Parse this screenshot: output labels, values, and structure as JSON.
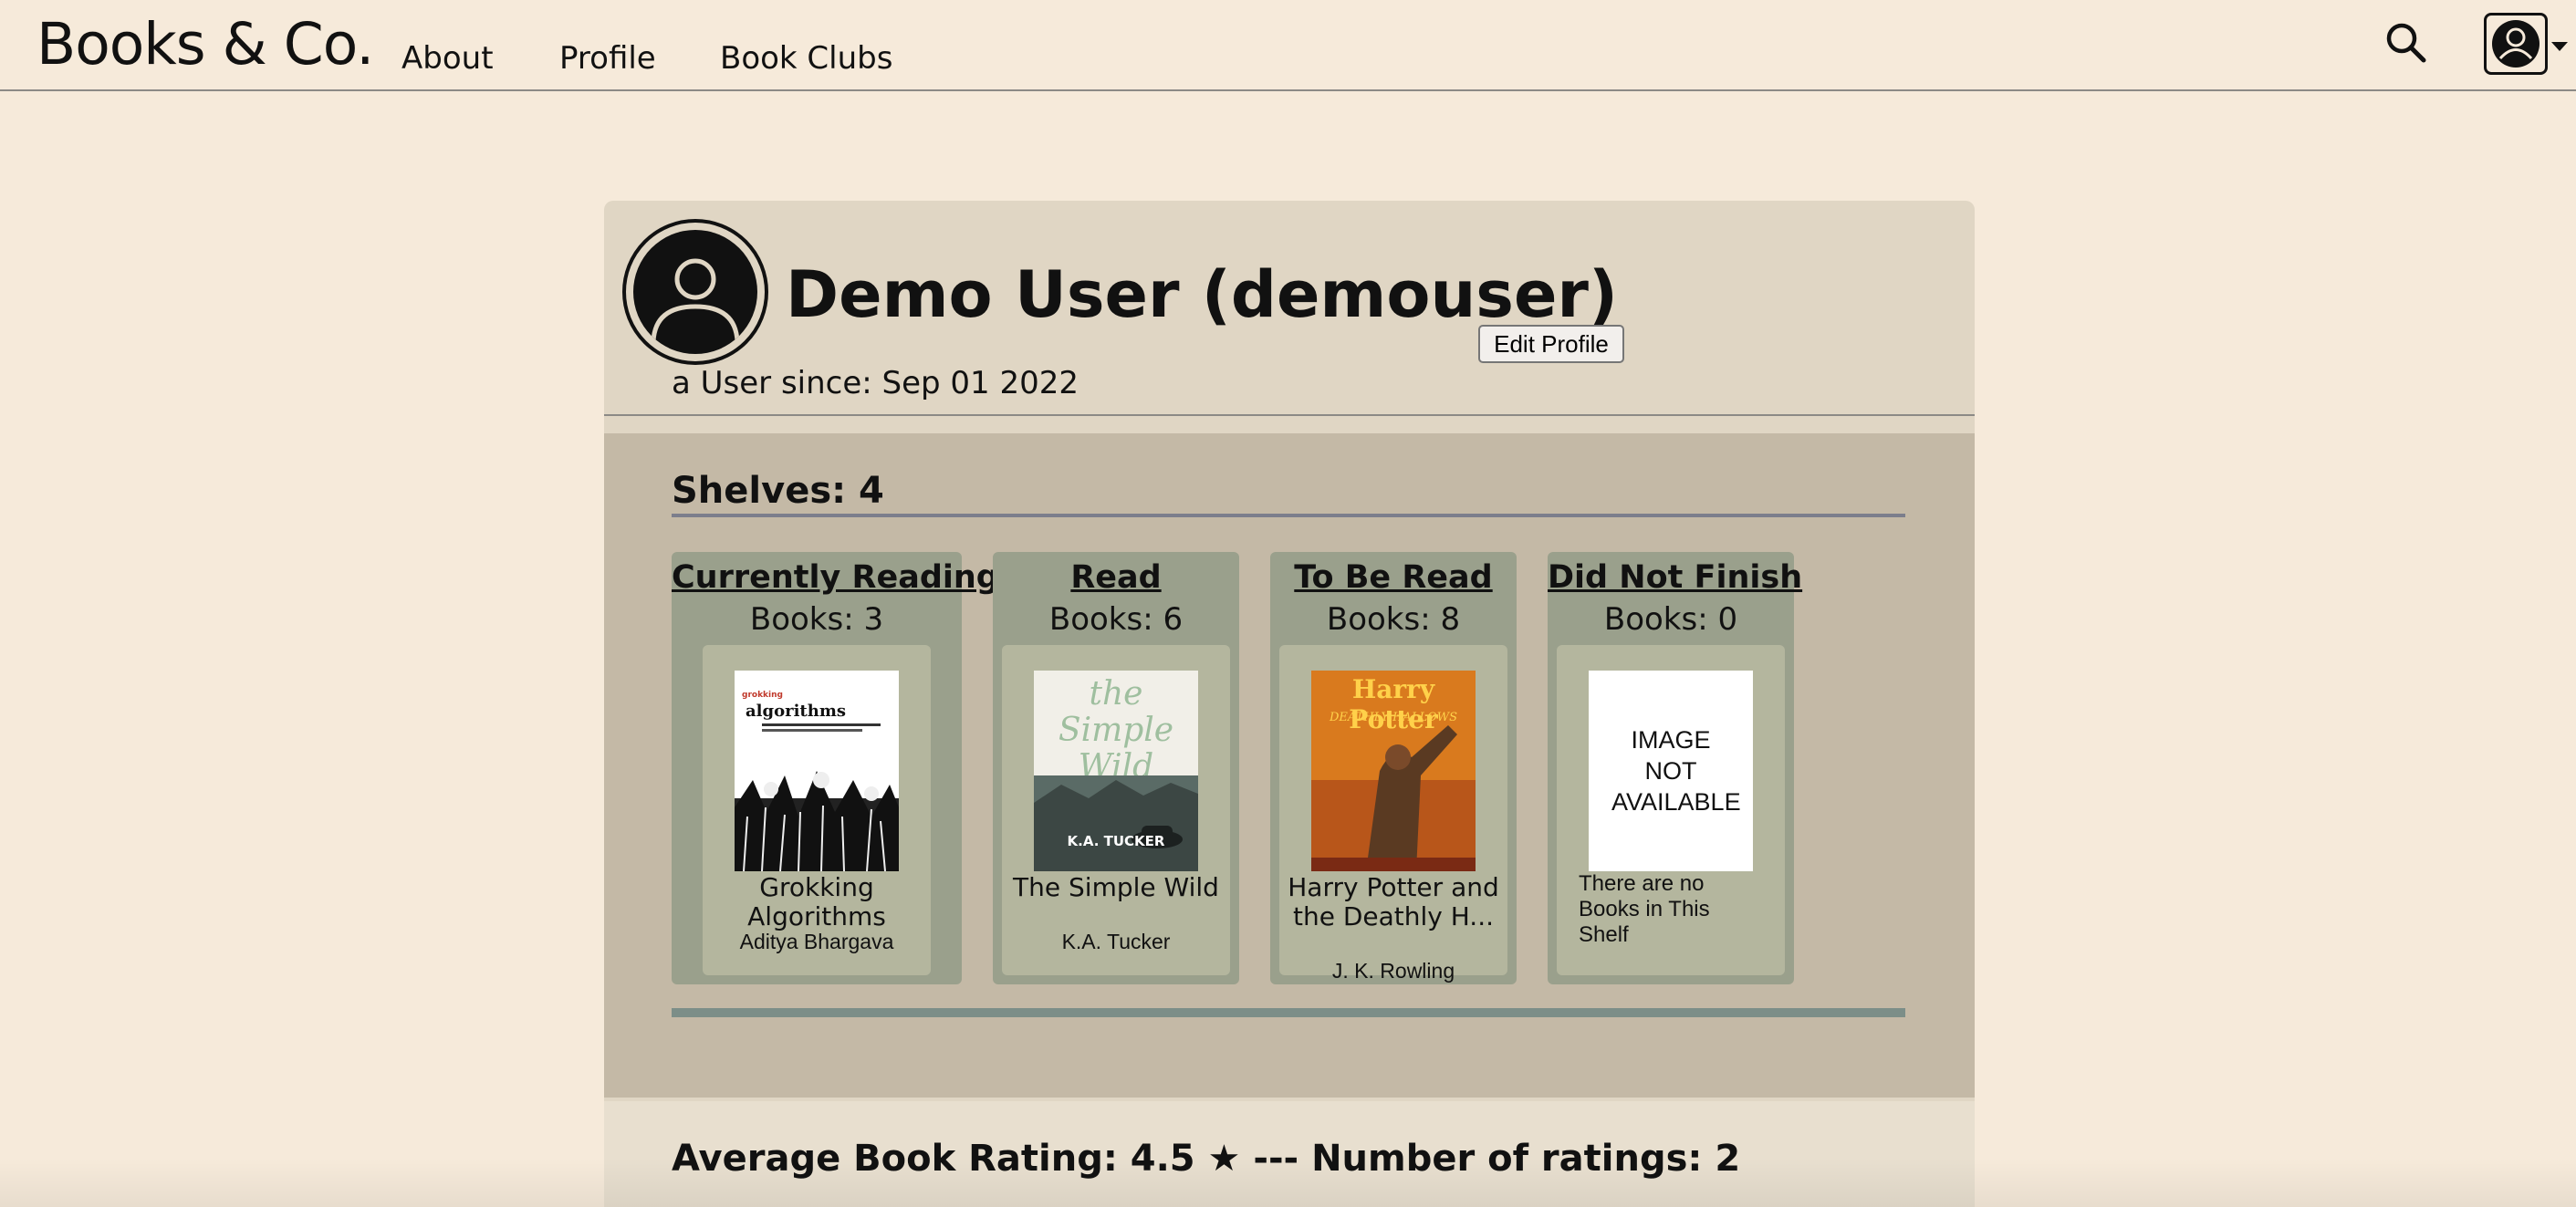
{
  "nav": {
    "brand": "Books & Co.",
    "links": [
      "About",
      "Profile",
      "Book Clubs"
    ]
  },
  "profile": {
    "name": "Demo User (demouser)",
    "edit_label": "Edit Profile",
    "since": "a User since: Sep 01 2022"
  },
  "shelves": {
    "heading": "Shelves: 4",
    "items": [
      {
        "title": "Currently Reading",
        "count": "Books: 3",
        "book": {
          "title": "Grokking Algorithms",
          "author": "Aditya Bhargava",
          "cover_top": "grokking",
          "cover_main": "algorithms"
        }
      },
      {
        "title": "Read",
        "count": "Books: 6",
        "book": {
          "title": "The Simple Wild",
          "author": "K.A. Tucker",
          "cover_top": "the Simple Wild",
          "cover_author": "K.A. TUCKER"
        }
      },
      {
        "title": "To Be Read",
        "count": "Books: 8",
        "book": {
          "title": "Harry Potter and the Deathly H...",
          "author": "J. K. Rowling",
          "cover_top": "Harry Potter",
          "cover_sub": "DEATHLY HALLOWS"
        }
      },
      {
        "title": "Did Not Finish",
        "count": "Books: 0",
        "placeholder": "IMAGE NOT AVAILABLE",
        "empty": "There are no Books in This Shelf"
      }
    ]
  },
  "rating": {
    "text": "Average Book Rating: 4.5 ★ --- Number of ratings: 2"
  },
  "colors": {
    "page_bg": "#f6eada",
    "card_bg": "#e0d6c4",
    "shelves_bg": "#c4b9a6",
    "shelf_bg": "#9aa08c",
    "book_box_bg": "#b4b69e"
  },
  "icons": [
    "search-icon",
    "user-icon",
    "chevron-down-icon"
  ]
}
